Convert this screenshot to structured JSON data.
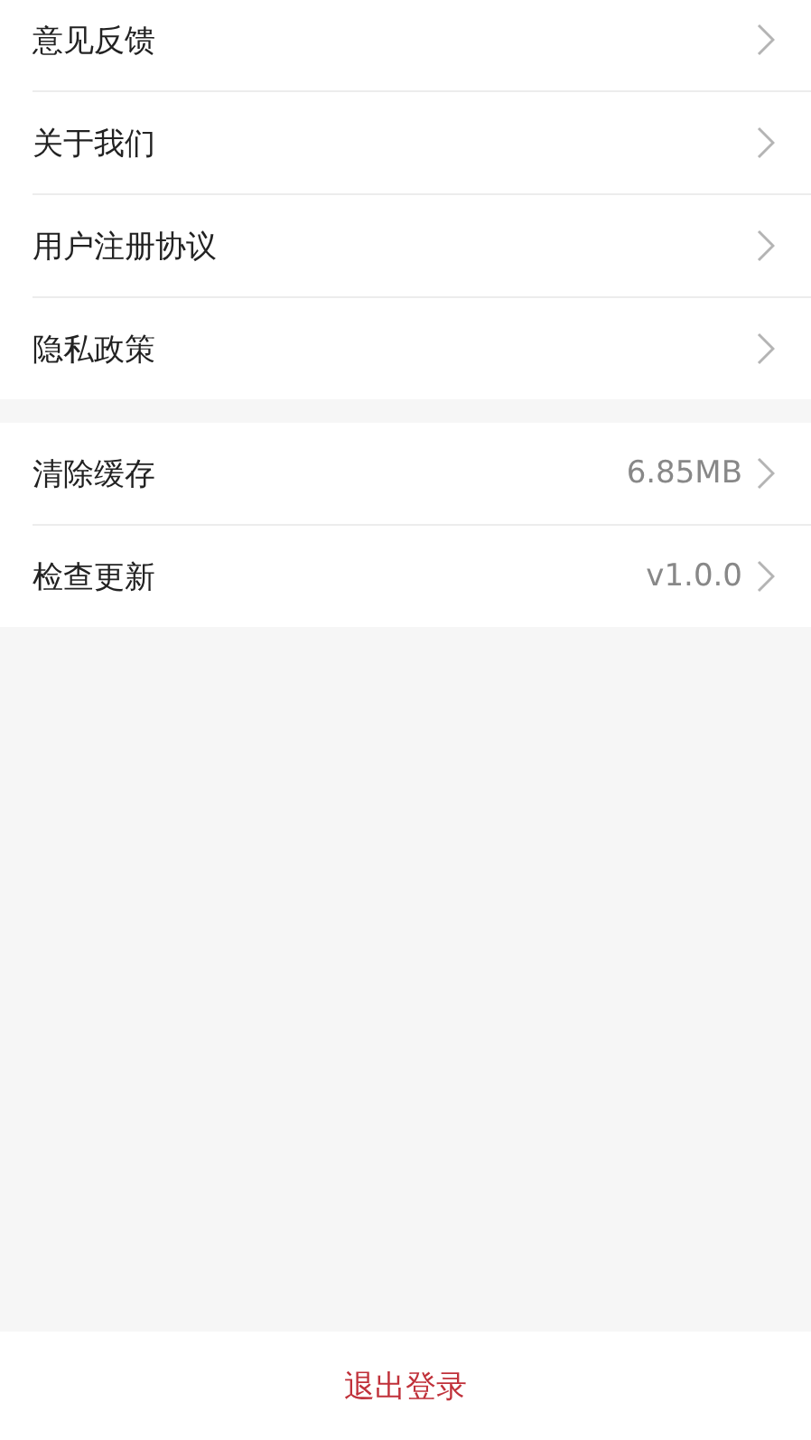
{
  "groups": [
    {
      "items": [
        {
          "label": "意见反馈"
        },
        {
          "label": "关于我们"
        },
        {
          "label": "用户注册协议"
        },
        {
          "label": "隐私政策"
        }
      ]
    },
    {
      "items": [
        {
          "label": "清除缓存",
          "value": "6.85MB"
        },
        {
          "label": "检查更新",
          "value": "v1.0.0"
        }
      ]
    }
  ],
  "logout_button": "退出登录"
}
